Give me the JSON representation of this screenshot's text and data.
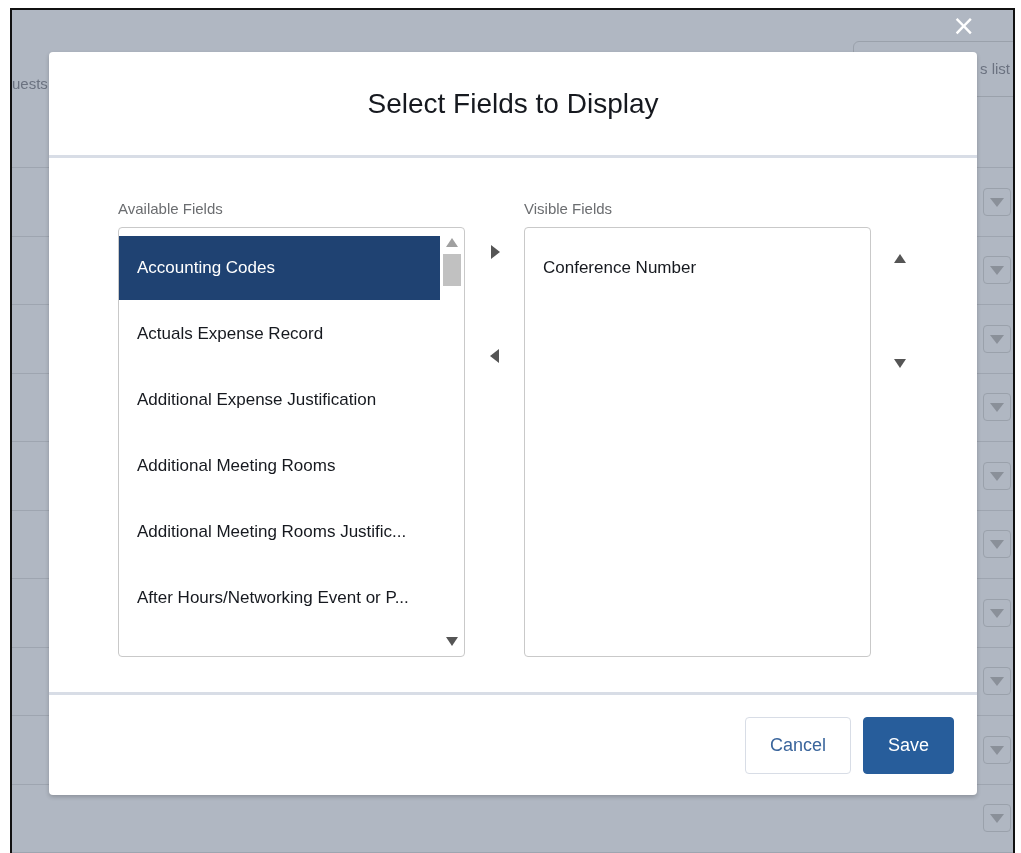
{
  "background": {
    "tab_text": "uests",
    "search_text": "s list"
  },
  "dialog": {
    "close_label": "×",
    "title": "Select Fields to Display",
    "available": {
      "label": "Available Fields",
      "items": [
        {
          "label": "Accounting Codes",
          "selected": true
        },
        {
          "label": "Actuals Expense Record",
          "selected": false
        },
        {
          "label": "Additional Expense Justification",
          "selected": false
        },
        {
          "label": "Additional Meeting Rooms",
          "selected": false
        },
        {
          "label": "Additional Meeting Rooms Justific...",
          "selected": false
        },
        {
          "label": "After Hours/Networking Event or P...",
          "selected": false
        }
      ]
    },
    "visible": {
      "label": "Visible Fields",
      "items": [
        {
          "label": "Conference Number",
          "selected": false
        }
      ]
    },
    "buttons": [
      {
        "label": "Cancel",
        "kind": "neutral"
      },
      {
        "label": "Save",
        "kind": "brand"
      }
    ]
  }
}
